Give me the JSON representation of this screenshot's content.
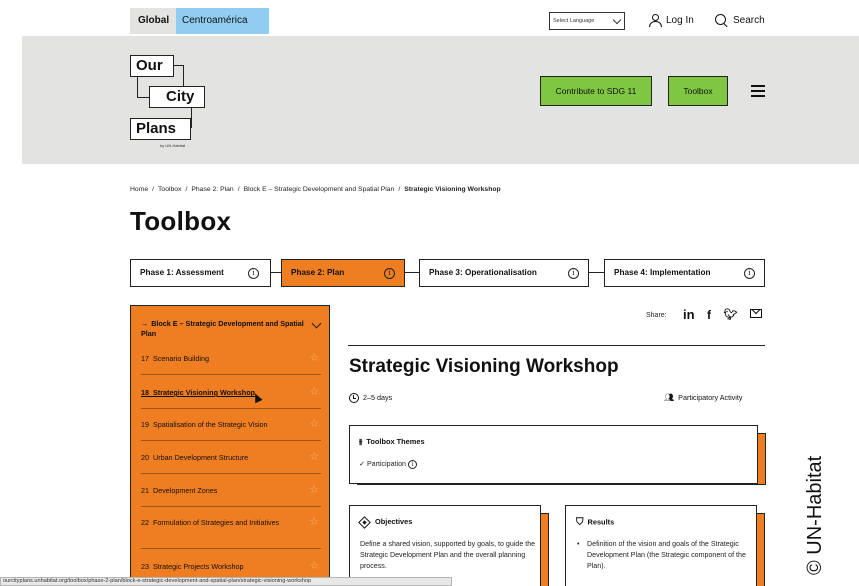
{
  "topbar": {
    "region_global": "Global",
    "region_centroamerica": "Centroamérica",
    "language_placeholder": "Select Language",
    "login_label": "Log In",
    "search_label": "Search"
  },
  "logo": {
    "line1": "Our",
    "line2": "City",
    "line3": "Plans",
    "byline": "by UN-Habitat"
  },
  "header_buttons": {
    "sdg": "Contribute to SDG 11",
    "toolbox": "Toolbox"
  },
  "breadcrumb": {
    "items": [
      "Home",
      "Toolbox",
      "Phase 2: Plan",
      "Block E – Strategic Development and Spatial Plan"
    ],
    "current": "Strategic Visioning Workshop"
  },
  "page_title": "Toolbox",
  "phases": [
    {
      "label": "Phase 1: Assessment",
      "active": false
    },
    {
      "label": "Phase 2: Plan",
      "active": true
    },
    {
      "label": "Phase 3: Operationalisation",
      "active": false
    },
    {
      "label": "Phase 4: Implementation",
      "active": false
    }
  ],
  "sidebar": {
    "block_title": "Block E – Strategic Development and Spatial Plan",
    "items": [
      {
        "num": "17",
        "label": "Scenario Building"
      },
      {
        "num": "18",
        "label": "Strategic Visioning Workshop",
        "current": true
      },
      {
        "num": "19",
        "label": "Spatialisation of the Strategic Vision"
      },
      {
        "num": "20",
        "label": "Urban Development Structure"
      },
      {
        "num": "21",
        "label": "Development Zones"
      },
      {
        "num": "22",
        "label": "Formulation of Strategies and Initiatives"
      },
      {
        "num": "23",
        "label": "Strategic Projects Workshop"
      }
    ]
  },
  "share": {
    "label": "Share:",
    "icons": [
      "linkedin-icon",
      "facebook-icon",
      "twitter-icon",
      "email-icon"
    ]
  },
  "content": {
    "title": "Strategic Visioning Workshop",
    "duration": "2–5 days",
    "activity_type": "Participatory Activity",
    "themes_heading": "Toolbox Themes",
    "theme_item": "Participation",
    "objectives_heading": "Objectives",
    "objectives_text": "Define a shared vision, supported by goals, to guide the Strategic Development Plan and the overall planning process.",
    "results_heading": "Results",
    "results_text": "Definition of the vision and goals of the Strategic Development Plan (the Strategic component of the Plan)."
  },
  "status_url": "ourcityplans.unhabitat.org/toolbox/phase-2-plan/block-e-strategic-development-and-spatial-plan/strategic-visioning-workshop",
  "watermark": "© UN-Habitat",
  "colors": {
    "orange": "#ef7d22",
    "green": "#7fc742",
    "light_blue": "#90cdf0",
    "grey_band": "#e3e3e1"
  }
}
